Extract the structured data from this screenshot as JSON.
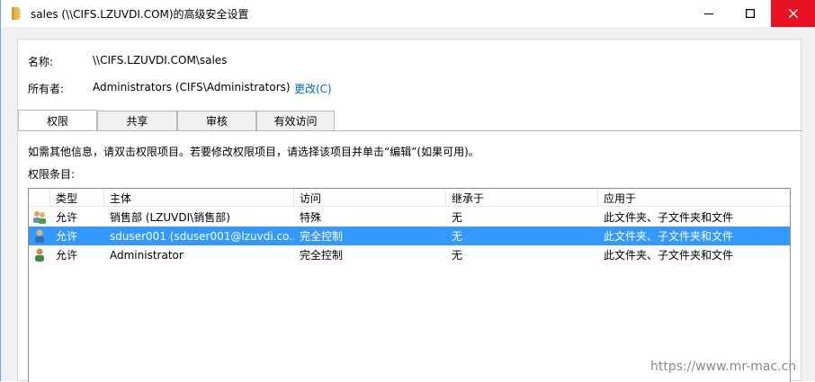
{
  "window": {
    "title": "sales (\\\\CIFS.LZUVDI.COM)的高级安全设置"
  },
  "name_row": {
    "label": "名称:",
    "value": "\\\\CIFS.LZUVDI.COM\\sales"
  },
  "owner_row": {
    "label": "所有者:",
    "value": "Administrators (CIFS\\Administrators)",
    "change_link": "更改(C)"
  },
  "tabs": [
    {
      "label": "权限",
      "active": true
    },
    {
      "label": "共享",
      "active": false
    },
    {
      "label": "审核",
      "active": false
    },
    {
      "label": "有效访问",
      "active": false
    }
  ],
  "info_text": "如需其他信息，请双击权限项目。若要修改权限项目，请选择该项目并单击“编辑”(如果可用)。",
  "entries_label": "权限条目:",
  "columns": [
    "类型",
    "主体",
    "访问",
    "继承于",
    "应用于"
  ],
  "rows": [
    {
      "icon": "group-users-icon",
      "type": "允许",
      "principal": "销售部 (LZUVDI\\销售部)",
      "access": "特殊",
      "inherited": "无",
      "applies": "此文件夹、子文件夹和文件",
      "selected": false
    },
    {
      "icon": "user-icon",
      "type": "允许",
      "principal": "sduser001 (sduser001@lzuvdi.co...",
      "access": "完全控制",
      "inherited": "无",
      "applies": "此文件夹、子文件夹和文件",
      "selected": true
    },
    {
      "icon": "admin-user-icon",
      "type": "允许",
      "principal": "Administrator",
      "access": "完全控制",
      "inherited": "无",
      "applies": "此文件夹、子文件夹和文件",
      "selected": false
    }
  ],
  "watermark": "https://www.mr-mac.cn",
  "colors": {
    "selection": "#3399ff",
    "link": "#0066cc",
    "close": "#e81123"
  }
}
